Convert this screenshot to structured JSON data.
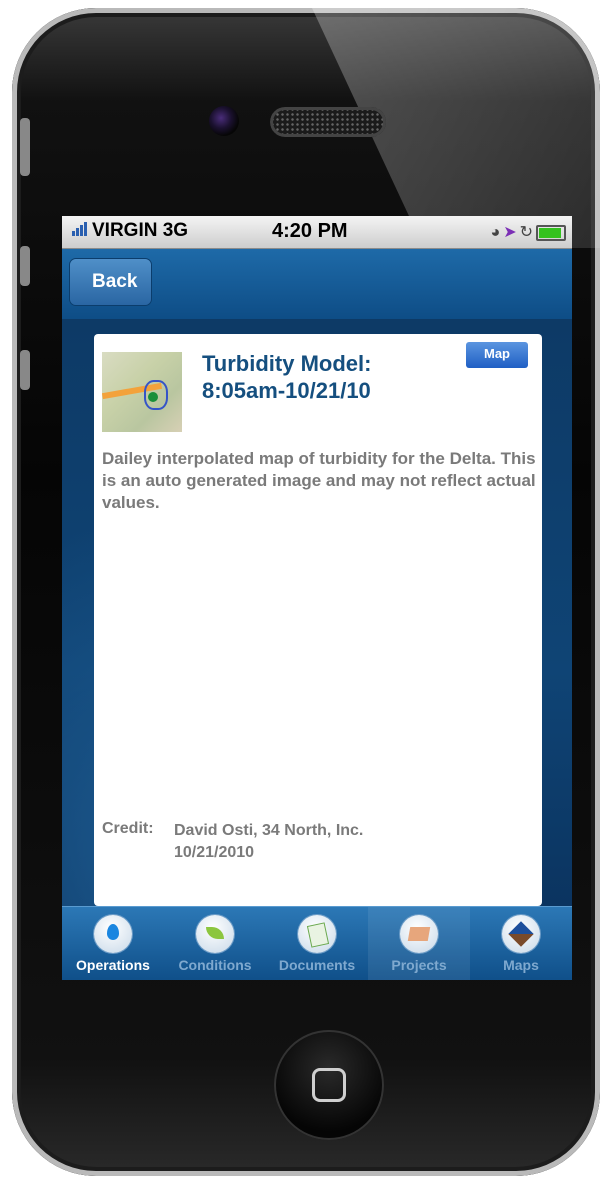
{
  "status_bar": {
    "carrier": "VIRGIN 3G",
    "time": "4:20 PM",
    "icons": [
      "clock-icon",
      "location-arrow-icon",
      "rotation-lock-icon",
      "battery-icon"
    ]
  },
  "nav": {
    "back_label": "Back"
  },
  "card": {
    "title_line1": "Turbidity Model:",
    "title_line2": "8:05am-10/21/10",
    "map_button": "Map",
    "description": "Dailey interpolated map of turbidity for the Delta. This is an auto generated image and may not reflect actual values.",
    "credit_label": "Credit:",
    "credit_name": "David Osti, 34 North, Inc.",
    "credit_date": "10/21/2010"
  },
  "tabs": [
    {
      "label": "Operations",
      "icon": "water-drop-icon",
      "active": true
    },
    {
      "label": "Conditions",
      "icon": "leaf-icon",
      "active": false
    },
    {
      "label": "Documents",
      "icon": "document-icon",
      "active": false
    },
    {
      "label": "Projects",
      "icon": "projects-icon",
      "active": false
    },
    {
      "label": "Maps",
      "icon": "map-icon",
      "active": false
    }
  ],
  "colors": {
    "nav_blue": "#1e6aa8",
    "title_blue": "#154f7f",
    "body_gray": "#7a7a7a",
    "map_button_blue": "#1f5fc4"
  }
}
